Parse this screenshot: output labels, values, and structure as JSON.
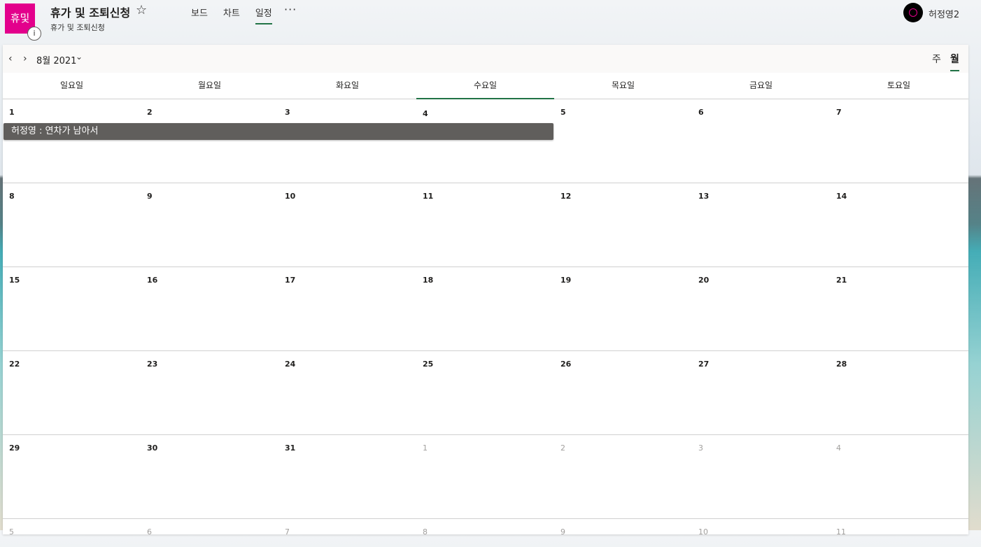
{
  "header": {
    "tile_text": "휴및",
    "info_icon": "i",
    "title": "휴가 및 조퇴신청",
    "star_icon": "☆",
    "subtitle": "휴가 및 조퇴신청",
    "nav": [
      {
        "label": "보드",
        "active": false
      },
      {
        "label": "차트",
        "active": false
      },
      {
        "label": "일정",
        "active": true
      }
    ],
    "more_icon": "···",
    "user_name": "허정영2"
  },
  "toolbar": {
    "prev_icon": "‹",
    "next_icon": "›",
    "month_label": "8월 2021",
    "month_chevron": "⌄",
    "view_week": "주",
    "view_month": "월"
  },
  "weekdays": [
    "일요일",
    "월요일",
    "화요일",
    "수요일",
    "목요일",
    "금요일",
    "토요일"
  ],
  "weeks": [
    [
      "1",
      "2",
      "3",
      "4",
      "5",
      "6",
      "7"
    ],
    [
      "8",
      "9",
      "10",
      "11",
      "12",
      "13",
      "14"
    ],
    [
      "15",
      "16",
      "17",
      "18",
      "19",
      "20",
      "21"
    ],
    [
      "22",
      "23",
      "24",
      "25",
      "26",
      "27",
      "28"
    ],
    [
      "29",
      "30",
      "31",
      "1",
      "2",
      "3",
      "4"
    ],
    [
      "5",
      "6",
      "7",
      "8",
      "9",
      "10",
      "11"
    ]
  ],
  "event": {
    "label": "허정영 : 연차가 남아서"
  },
  "colors": {
    "accent": "#217346",
    "tile": "#e3008c",
    "event": "#605e5c"
  }
}
